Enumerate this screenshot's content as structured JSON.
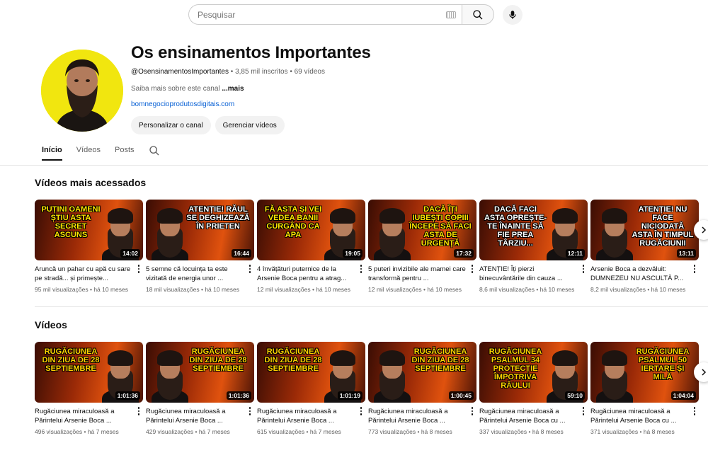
{
  "search": {
    "placeholder": "Pesquisar"
  },
  "channel": {
    "title": "Os ensinamentos Importantes",
    "handle": "@OsensinamentosImportantes",
    "subscribers": "3,85 mil inscritos",
    "videos_count": "69 vídeos",
    "description": "Saiba mais sobre este canal",
    "more_label": "...mais",
    "link": "bomnegocioprodutosdigitais.com",
    "customize_label": "Personalizar o canal",
    "manage_label": "Gerenciar vídeos"
  },
  "tabs": [
    "Início",
    "Vídeos",
    "Posts"
  ],
  "sections": [
    {
      "title": "Vídeos mais acessados",
      "videos": [
        {
          "thumb_text": "PUȚINI OAMENI ȘTIU ASTA SECRET ASCUNS",
          "duration": "14:02",
          "title": "Aruncă un pahar cu apă cu sare pe stradă... și primește...",
          "views": "95 mil visualizações",
          "age": "há 10 meses",
          "text_color": "#ffe600"
        },
        {
          "thumb_text": "ATENȚIE! RĂUL SE DEGHIZEAZĂ ÎN PRIETEN",
          "duration": "16:44",
          "title": "5 semne că locuința ta este vizitată de energia unor ...",
          "views": "18 mil visualizações",
          "age": "há 10 meses",
          "text_color": "#ffffff"
        },
        {
          "thumb_text": "FĂ ASTA ȘI VEI VEDEA BANII CURGÂND CA APA",
          "duration": "19:05",
          "title": "4 învățături puternice de la Arsenie Boca pentru a atrag...",
          "views": "12 mil visualizações",
          "age": "há 10 meses",
          "text_color": "#ffe600"
        },
        {
          "thumb_text": "DACĂ ÎȚI IUBEȘTI COPIII ÎNCEPE SĂ FACI ASTA DE URGENȚĂ",
          "duration": "17:32",
          "title": "5 puteri invizibile ale mamei care transformă pentru ...",
          "views": "12 mil visualizações",
          "age": "há 10 meses",
          "text_color": "#ffe600"
        },
        {
          "thumb_text": "DACĂ FACI ASTA OPREȘTE-TE ÎNAINTE SĂ FIE PREA TÂRZIU...",
          "duration": "12:11",
          "title": "ATENȚIE! Îți pierzi binecuvântările din cauza ...",
          "views": "8,6 mil visualizações",
          "age": "há 10 meses",
          "text_color": "#ffffff"
        },
        {
          "thumb_text": "ATENȚIE! NU FACE NICIODATĂ ASTA ÎN TIMPUL RUGĂCIUNII",
          "duration": "13:11",
          "title": "Arsenie Boca a dezvăluit: DUMNEZEU NU ASCULTĂ P...",
          "views": "8,2 mil visualizações",
          "age": "há 10 meses",
          "text_color": "#ffffff"
        }
      ]
    },
    {
      "title": "Vídeos",
      "videos": [
        {
          "thumb_text": "RUGĂCIUNEA DIN ZIUA DE 28 SEPTIEMBRE",
          "duration": "1:01:36",
          "title": "Rugăciunea miraculoasă a Părintelui Arsenie Boca ...",
          "views": "496 visualizações",
          "age": "há 7 meses",
          "text_color": "#ffd200"
        },
        {
          "thumb_text": "RUGĂCIUNEA DIN ZIUA DE 28 SEPTIEMBRE",
          "duration": "1:01:36",
          "title": "Rugăciunea miraculoasă a Părintelui Arsenie Boca ...",
          "views": "429 visualizações",
          "age": "há 7 meses",
          "text_color": "#ffd200"
        },
        {
          "thumb_text": "RUGĂCIUNEA DIN ZIUA DE 28 SEPTIEMBRE",
          "duration": "1:01:19",
          "title": "Rugăciunea miraculoasă a Părintelui Arsenie Boca ...",
          "views": "615 visualizações",
          "age": "há 7 meses",
          "text_color": "#ffd200"
        },
        {
          "thumb_text": "RUGĂCIUNEA DIN ZIUA DE 28 SEPTIEMBRE",
          "duration": "1:00:45",
          "title": "Rugăciunea miraculoasă a Părintelui Arsenie Boca ...",
          "views": "773 visualizações",
          "age": "há 8 meses",
          "text_color": "#ffd200"
        },
        {
          "thumb_text": "RUGĂCIUNEA PSALMUL 34 PROTECȚIE ÎMPOTRIVA RĂULUI",
          "duration": "59:10",
          "title": "Rugăciunea miraculoasă a Părintelui Arsenie Boca cu ...",
          "views": "337 visualizações",
          "age": "há 8 meses",
          "text_color": "#ffd200"
        },
        {
          "thumb_text": "RUGĂCIUNEA PSALMUL 50 IERTARE ȘI MILĂ",
          "duration": "1:04:04",
          "title": "Rugăciunea miraculoasă a Părintelui Arsenie Boca cu ...",
          "views": "371 visualizações",
          "age": "há 8 meses",
          "text_color": "#ffd200"
        }
      ]
    }
  ],
  "colors": {
    "accent": "#0f0f0f",
    "link": "#065fd4",
    "avatar_bg": "#f1e60f"
  }
}
